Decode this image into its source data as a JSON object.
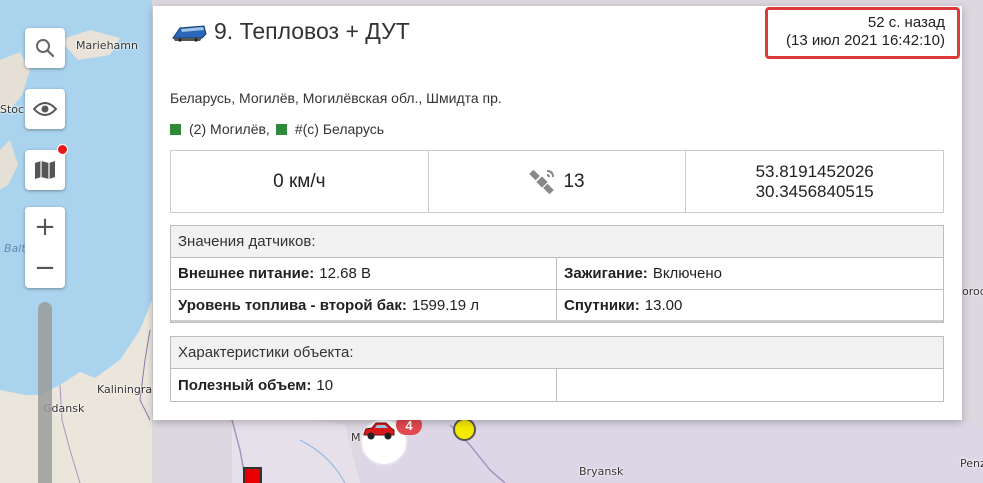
{
  "map": {
    "labels": {
      "mariehamn": "Mariehamn",
      "stockholm": "Stoc",
      "baltic": "Balt",
      "kaliningrad": "Kaliningra",
      "gdansk": "Gdansk",
      "bryansk": "Bryansk",
      "penza": "Penza",
      "gorod": "orod",
      "minsk": "M"
    },
    "controls": {
      "search_icon": "search-icon",
      "eye_icon": "eye-icon",
      "map_icon": "map-icon",
      "zoom_in": "+",
      "zoom_out": "−"
    },
    "markers": {
      "car_badge_count": "4"
    }
  },
  "popup": {
    "vehicle_icon": "locomotive-icon",
    "title": "9. Тепловоз + ДУТ",
    "time_ago": "52 с. назад",
    "timestamp": "(13 июл 2021 16:42:10)",
    "address": "Беларусь, Могилёв, Могилёвская обл., Шмидта пр.",
    "groups": [
      "(2) Могилёв,",
      "#(с) Беларусь"
    ],
    "speed": "0 км/ч",
    "satellites_icon": "satellite-icon",
    "satellites": "13",
    "latitude": "53.8191452026",
    "longitude": "30.3456840515",
    "sensors": {
      "heading": "Значения датчиков:",
      "rows": [
        [
          {
            "key": "Внешнее питание:",
            "value": "12.68 В"
          },
          {
            "key": "Зажигание:",
            "value": "Включено"
          }
        ],
        [
          {
            "key": "Уровень топлива - второй бак:",
            "value": "1599.19 л"
          },
          {
            "key": "Спутники:",
            "value": "13.00"
          }
        ]
      ]
    },
    "properties": {
      "heading": "Характеристики объекта:",
      "rows": [
        [
          {
            "key": "Полезный объем:",
            "value": "10"
          },
          {
            "key": "",
            "value": ""
          }
        ]
      ]
    }
  },
  "colors": {
    "accent_red": "#dc3a3a",
    "group_green": "#2e8a3a",
    "badge": "#e34850"
  }
}
